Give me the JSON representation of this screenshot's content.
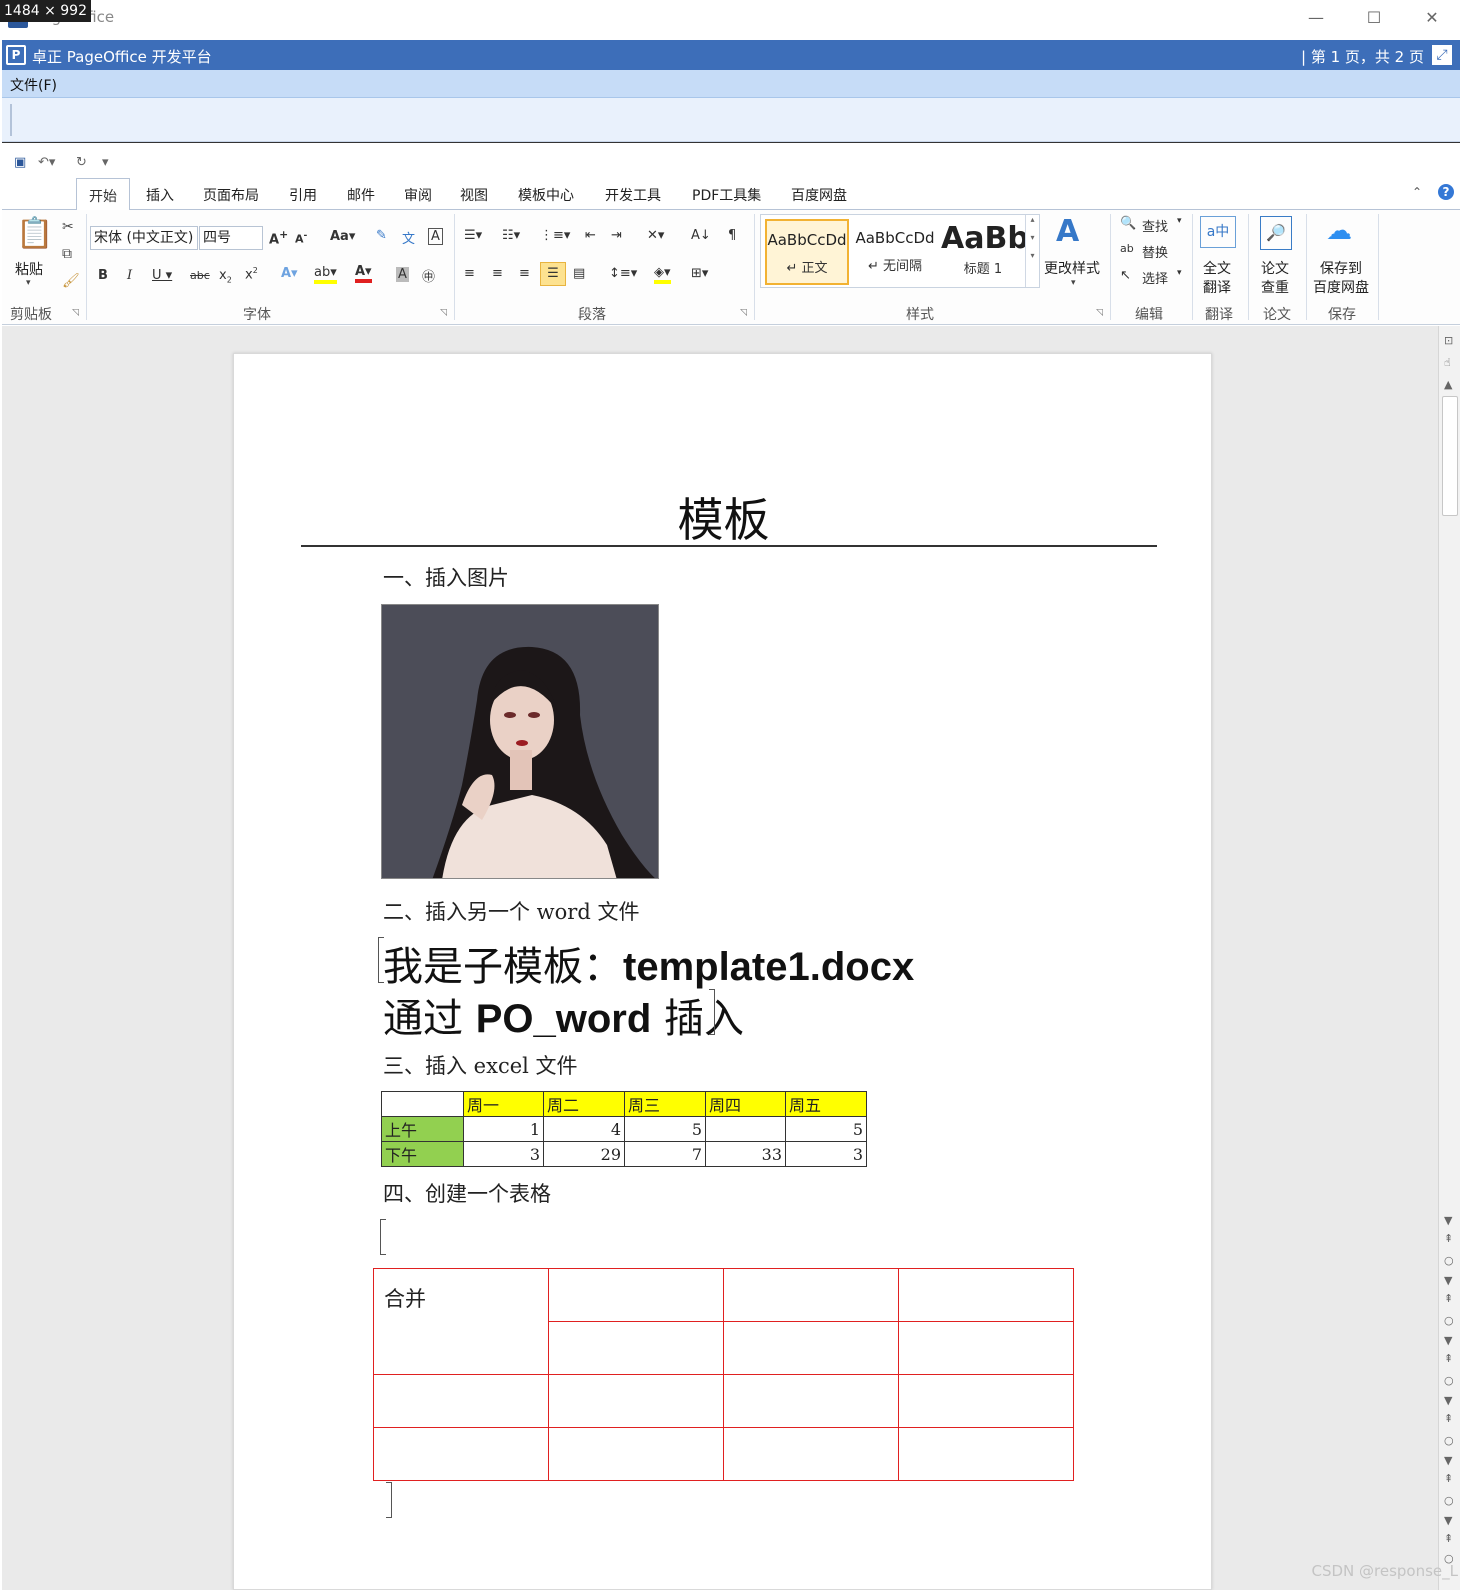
{
  "window": {
    "size_badge": "1484 × 992",
    "title": "PageOffice",
    "minimize": "—",
    "maximize": "☐",
    "close": "✕"
  },
  "app": {
    "title": "卓正 PageOffice 开发平台",
    "page_info": "| 第 1 页，共 2 页",
    "menu_file": "文件(F)"
  },
  "ribbon": {
    "tabs": [
      "开始",
      "插入",
      "页面布局",
      "引用",
      "邮件",
      "审阅",
      "视图",
      "模板中心",
      "开发工具",
      "PDF工具集",
      "百度网盘"
    ],
    "clipboard": {
      "paste": "粘贴",
      "group": "剪贴板"
    },
    "font": {
      "name": "宋体 (中文正文)",
      "size": "四号",
      "group": "字体"
    },
    "paragraph": {
      "group": "段落"
    },
    "styles": {
      "group": "样式",
      "items": [
        {
          "sample": "AaBbCcDd",
          "name": "↵ 正文"
        },
        {
          "sample": "AaBbCcDd",
          "name": "↵ 无间隔"
        },
        {
          "sample": "AaBb",
          "name": "标题 1"
        }
      ],
      "change_styles": "更改样式"
    },
    "edit": {
      "find": "查找",
      "replace": "替换",
      "select": "选择",
      "group": "编辑"
    },
    "translate": {
      "button": [
        "全文",
        "翻译"
      ],
      "group": "翻译"
    },
    "paper": {
      "button": [
        "论文",
        "查重"
      ],
      "group": "论文"
    },
    "save": {
      "button": [
        "保存到",
        "百度网盘"
      ],
      "group": "保存"
    }
  },
  "document": {
    "title": "模板",
    "h1": "一、插入图片",
    "h2": "二、插入另一个 word 文件",
    "sub1_cn": "我是子模板：",
    "sub1_en": "template1.docx",
    "sub2_cn1": "通过 ",
    "sub2_en": "PO_word",
    "sub2_cn2": " 插入",
    "h3": "三、插入 excel 文件",
    "excel": {
      "headers": [
        "",
        "周一",
        "周二",
        "周三",
        "周四",
        "周五"
      ],
      "rows": [
        [
          "上午",
          "1",
          "4",
          "5",
          "",
          "5"
        ],
        [
          "下午",
          "3",
          "29",
          "7",
          "33",
          "3"
        ]
      ]
    },
    "h4": "四、创建一个表格",
    "merged_cell": "合并"
  },
  "footer": {
    "watermark": "CSDN @response_L"
  },
  "colors": {
    "title_bar": "#3d6eb9",
    "menu_bar": "#c6dcf7",
    "excel_header": "#ffff00",
    "excel_row_label": "#92d050",
    "table_border": "#e02020"
  }
}
